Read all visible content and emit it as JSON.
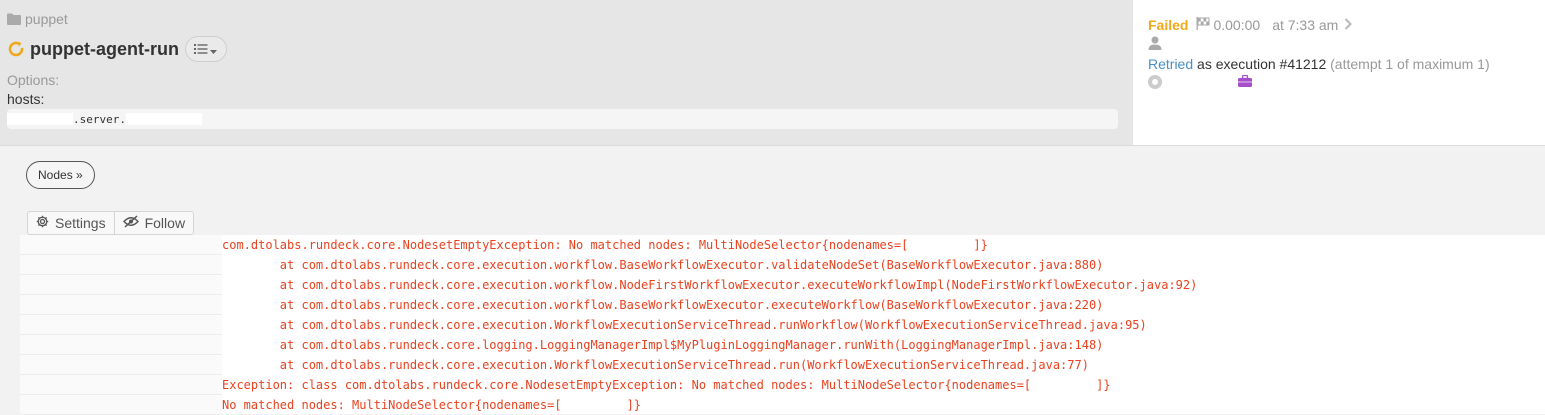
{
  "header": {
    "breadcrumb": "puppet",
    "job_title": "puppet-agent-run",
    "options_label": "Options:",
    "hosts_label": "hosts:",
    "hosts_value": ".server."
  },
  "status": {
    "state": "Failed",
    "duration": "0.00:00",
    "time": "at 7:33 am",
    "retried_label": "Retried",
    "execution_text": "as execution #41212",
    "attempt_text": "(attempt 1 of maximum 1)",
    "colors": {
      "failed": "#f0a81e",
      "link": "#4a90c8"
    }
  },
  "controls": {
    "nodes_label": "Nodes »",
    "settings_label": "Settings",
    "follow_label": "Follow"
  },
  "log": {
    "lines": [
      "com.dtolabs.rundeck.core.NodesetEmptyException: No matched nodes: MultiNodeSelector{nodenames=[         ]}",
      "        at com.dtolabs.rundeck.core.execution.workflow.BaseWorkflowExecutor.validateNodeSet(BaseWorkflowExecutor.java:880)",
      "        at com.dtolabs.rundeck.core.execution.workflow.NodeFirstWorkflowExecutor.executeWorkflowImpl(NodeFirstWorkflowExecutor.java:92)",
      "        at com.dtolabs.rundeck.core.execution.workflow.BaseWorkflowExecutor.executeWorkflow(BaseWorkflowExecutor.java:220)",
      "        at com.dtolabs.rundeck.core.execution.WorkflowExecutionServiceThread.runWorkflow(WorkflowExecutionServiceThread.java:95)",
      "        at com.dtolabs.rundeck.core.logging.LoggingManagerImpl$MyPluginLoggingManager.runWith(LoggingManagerImpl.java:148)",
      "        at com.dtolabs.rundeck.core.execution.WorkflowExecutionServiceThread.run(WorkflowExecutionServiceThread.java:77)",
      "Exception: class com.dtolabs.rundeck.core.NodesetEmptyException: No matched nodes: MultiNodeSelector{nodenames=[         ]}",
      "No matched nodes: MultiNodeSelector{nodenames=[         ]}"
    ],
    "color": "#e8421f"
  }
}
